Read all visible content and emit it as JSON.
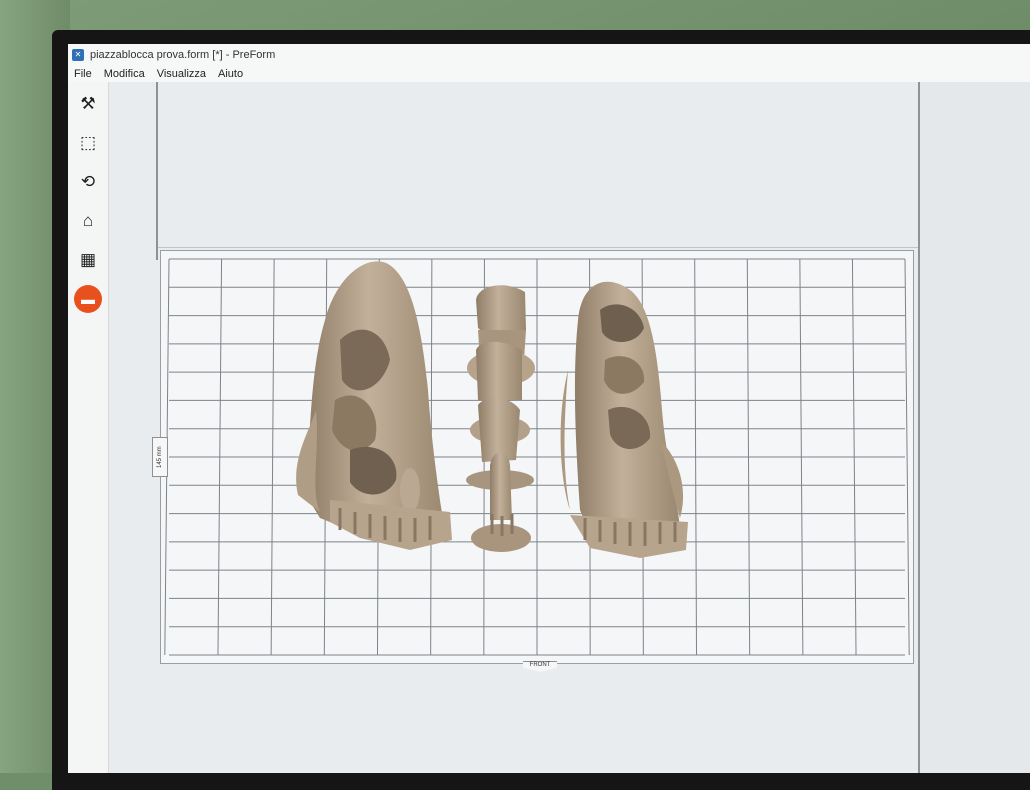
{
  "window": {
    "title": "piazzablocca prova.form [*] - PreForm",
    "app_icon": "preform-app-icon"
  },
  "menu": {
    "items": [
      "File",
      "Modifica",
      "Visualizza",
      "Aiuto"
    ]
  },
  "toolbar": {
    "tools": [
      {
        "name": "magic-wand-icon",
        "glyph": "⚒"
      },
      {
        "name": "selection-box-icon",
        "glyph": "⬚"
      },
      {
        "name": "orientation-icon",
        "glyph": "⟲"
      },
      {
        "name": "supports-icon",
        "glyph": "⌂"
      },
      {
        "name": "layout-icon",
        "glyph": "▦"
      },
      {
        "name": "print-icon",
        "glyph": "▬",
        "active": true
      }
    ],
    "active_color": "#e8501e"
  },
  "viewport": {
    "side_dimension_label": "145 mm",
    "front_label": "FRONT",
    "model_color": "#b3a08a",
    "support_color": "#a8967f"
  }
}
